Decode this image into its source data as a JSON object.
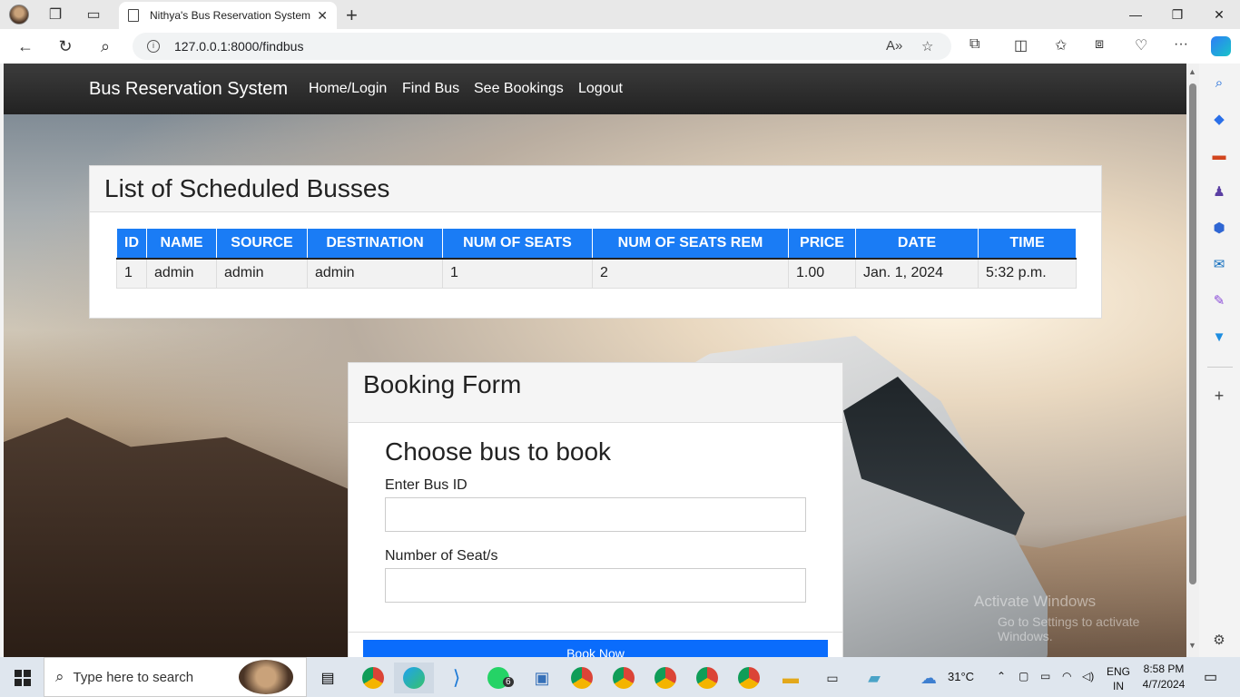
{
  "browser": {
    "tab_title": "Nithya's Bus Reservation System",
    "url": "127.0.0.1:8000/findbus"
  },
  "site": {
    "brand": "Bus Reservation System",
    "nav": [
      "Home/Login",
      "Find Bus",
      "See Bookings",
      "Logout"
    ]
  },
  "schedule": {
    "title": "List of Scheduled Busses",
    "columns": [
      "ID",
      "NAME",
      "SOURCE",
      "DESTINATION",
      "NUM OF SEATS",
      "NUM OF SEATS REM",
      "PRICE",
      "DATE",
      "TIME"
    ],
    "rows": [
      [
        "1",
        "admin",
        "admin",
        "admin",
        "1",
        "2",
        "1.00",
        "Jan. 1, 2024",
        "5:32 p.m."
      ]
    ]
  },
  "booking": {
    "title": "Booking Form",
    "subtitle": "Choose bus to book",
    "bus_id_label": "Enter Bus ID",
    "seats_label": "Number of Seat/s",
    "submit_label": "Book Now"
  },
  "watermark": {
    "line1": "Activate Windows",
    "line2": "Go to Settings to activate Windows."
  },
  "taskbar": {
    "search_placeholder": "Type here to search",
    "whatsapp_badge": "6",
    "weather": "31°C",
    "lang1": "ENG",
    "lang2": "IN",
    "time": "8:58 PM",
    "date": "4/7/2024"
  },
  "colors": {
    "table_header": "#1a7cf5",
    "book_button": "#0a6cfc",
    "navbar": "#222222"
  }
}
